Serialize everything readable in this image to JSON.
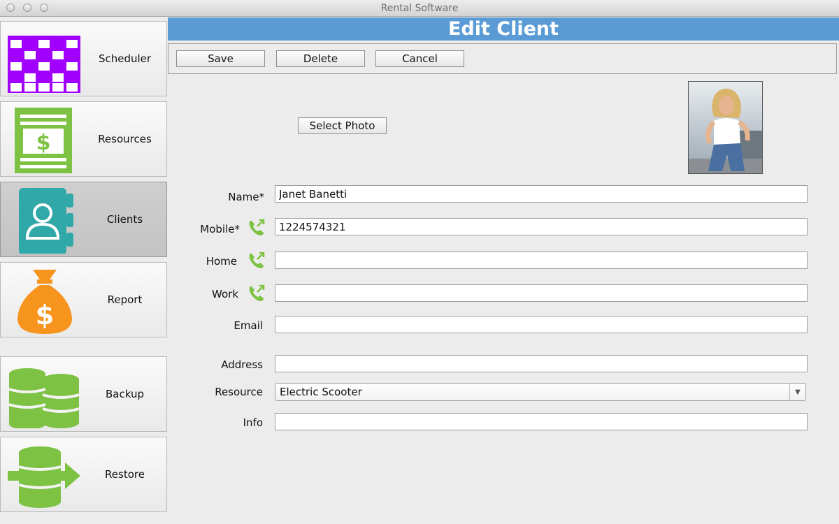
{
  "window": {
    "title": "Rental Software"
  },
  "sidebar": {
    "items": [
      {
        "label": "Scheduler",
        "icon": "calendar-icon",
        "color": "#a100ff"
      },
      {
        "label": "Resources",
        "icon": "price-list-icon",
        "color": "#7dc242"
      },
      {
        "label": "Clients",
        "icon": "address-book-icon",
        "color": "#30a8a8",
        "active": true
      },
      {
        "label": "Report",
        "icon": "money-bag-icon",
        "color": "#f7941d"
      },
      {
        "label": "Backup",
        "icon": "database-icon",
        "color": "#7dc242"
      },
      {
        "label": "Restore",
        "icon": "restore-database-icon",
        "color": "#7dc242"
      }
    ]
  },
  "header": {
    "title": "Edit Client",
    "color": "#5b9bd5"
  },
  "toolbar": {
    "save_label": "Save",
    "delete_label": "Delete",
    "cancel_label": "Cancel"
  },
  "photo": {
    "select_label": "Select Photo"
  },
  "form": {
    "name_label": "Name*",
    "name_value": "Janet Banetti",
    "mobile_label": "Mobile*",
    "mobile_value": "1224574321",
    "home_label": "Home",
    "home_value": "",
    "work_label": "Work",
    "work_value": "",
    "email_label": "Email",
    "email_value": "",
    "address_label": "Address",
    "address_value": "",
    "resource_label": "Resource",
    "resource_value": "Electric Scooter",
    "info_label": "Info",
    "info_value": ""
  }
}
